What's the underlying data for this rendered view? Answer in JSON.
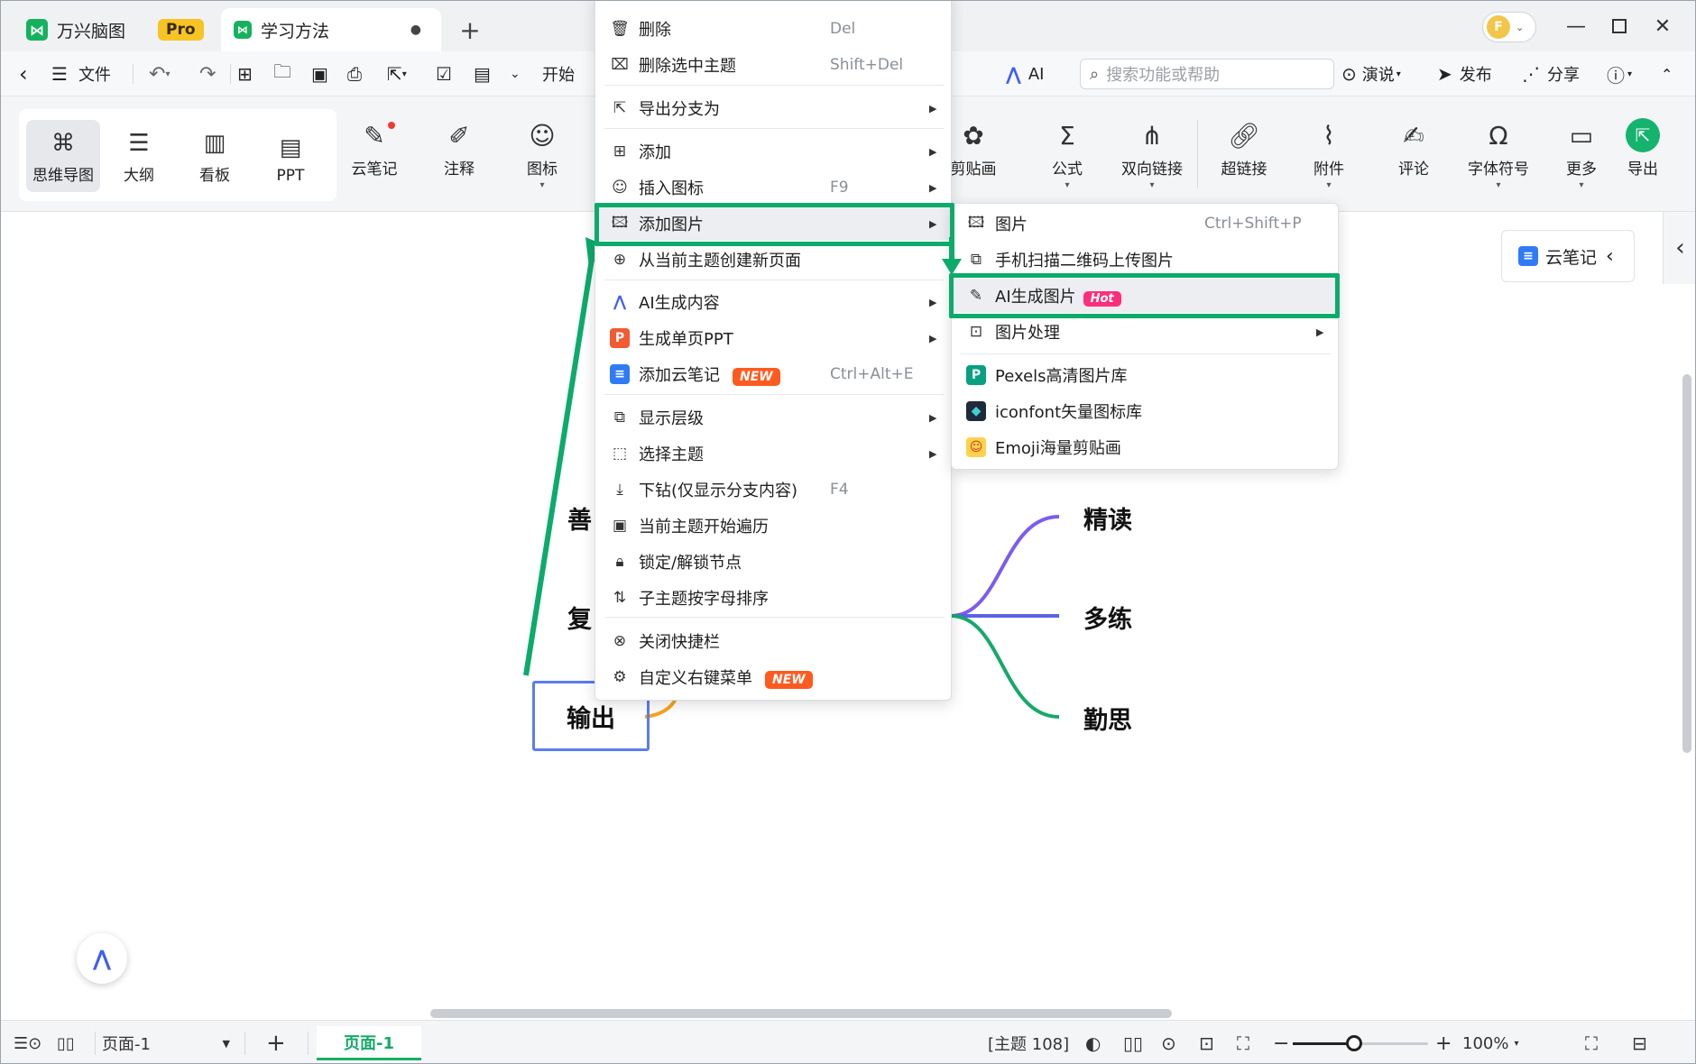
{
  "titlebar": {
    "app_name": "万兴脑图",
    "pro_badge": "Pro",
    "doc_tab": "学习方法",
    "unsaved_dot": "●",
    "new_tab": "+",
    "avatar_letter": "F"
  },
  "toolbar": {
    "file_label": "文件",
    "start_label": "开始",
    "ai_label": "AI",
    "search_placeholder": "搜索功能或帮助",
    "present_label": "演说",
    "publish_label": "发布",
    "share_label": "分享"
  },
  "views": [
    {
      "label": "思维导图"
    },
    {
      "label": "大纲"
    },
    {
      "label": "看板"
    },
    {
      "label": "PPT"
    }
  ],
  "ribbon": {
    "cloud_note": "云笔记",
    "annotation": "注释",
    "icon": "图标",
    "clipart": "剪贴画",
    "formula": "公式",
    "bilink": "双向链接",
    "hyperlink": "超链接",
    "attachment": "附件",
    "comment": "评论",
    "symbol": "字体符号",
    "more": "更多",
    "export": "导出"
  },
  "context_menu": {
    "delete": {
      "label": "删除",
      "shortcut": "Del"
    },
    "delete_selected": {
      "label": "删除选中主题",
      "shortcut": "Shift+Del"
    },
    "export_branch": {
      "label": "导出分支为"
    },
    "add": {
      "label": "添加"
    },
    "insert_icon": {
      "label": "插入图标",
      "shortcut": "F9"
    },
    "add_image": {
      "label": "添加图片"
    },
    "new_page": {
      "label": "从当前主题创建新页面"
    },
    "ai_content": {
      "label": "AI生成内容"
    },
    "single_ppt": {
      "label": "生成单页PPT"
    },
    "add_cloud_note": {
      "label": "添加云笔记",
      "badge": "NEW",
      "shortcut": "Ctrl+Alt+E"
    },
    "show_level": {
      "label": "显示层级"
    },
    "select_topic": {
      "label": "选择主题"
    },
    "drill_down": {
      "label": "下钻(仅显示分支内容)",
      "shortcut": "F4"
    },
    "traverse": {
      "label": "当前主题开始遍历"
    },
    "lock": {
      "label": "锁定/解锁节点"
    },
    "sort": {
      "label": "子主题按字母排序"
    },
    "close_quickbar": {
      "label": "关闭快捷栏"
    },
    "custom_menu": {
      "label": "自定义右键菜单",
      "badge": "NEW"
    }
  },
  "submenu": {
    "image": {
      "label": "图片",
      "shortcut": "Ctrl+Shift+P"
    },
    "scan_qr": {
      "label": "手机扫描二维码上传图片"
    },
    "ai_image": {
      "label": "AI生成图片",
      "badge": "Hot"
    },
    "image_process": {
      "label": "图片处理"
    },
    "pexels": {
      "label": "Pexels高清图片库"
    },
    "iconfont": {
      "label": "iconfont矢量图标库"
    },
    "emoji": {
      "label": "Emoji海量剪贴画"
    }
  },
  "mindmap": {
    "node_shan": "善",
    "node_fu": "复",
    "node_output": "输出",
    "node_jingdu": "精读",
    "node_duolian": "多练",
    "node_qinsi": "勤思",
    "branch_colors": [
      "#7b5cf0",
      "#5a62e6",
      "#16a86a"
    ]
  },
  "side_panel": {
    "cloud_note": "云笔记"
  },
  "statusbar": {
    "page_select": "页面-1",
    "add_page": "+",
    "page_tab": "页面-1",
    "topic_count": "[主题 108]",
    "zoom": "100%",
    "zoom_level": 0.45
  },
  "colors": {
    "highlight": "#0cab6b",
    "accent": "#16b15e",
    "new_badge": "#ff5a1f",
    "hot_badge": "#ff2e7a"
  }
}
